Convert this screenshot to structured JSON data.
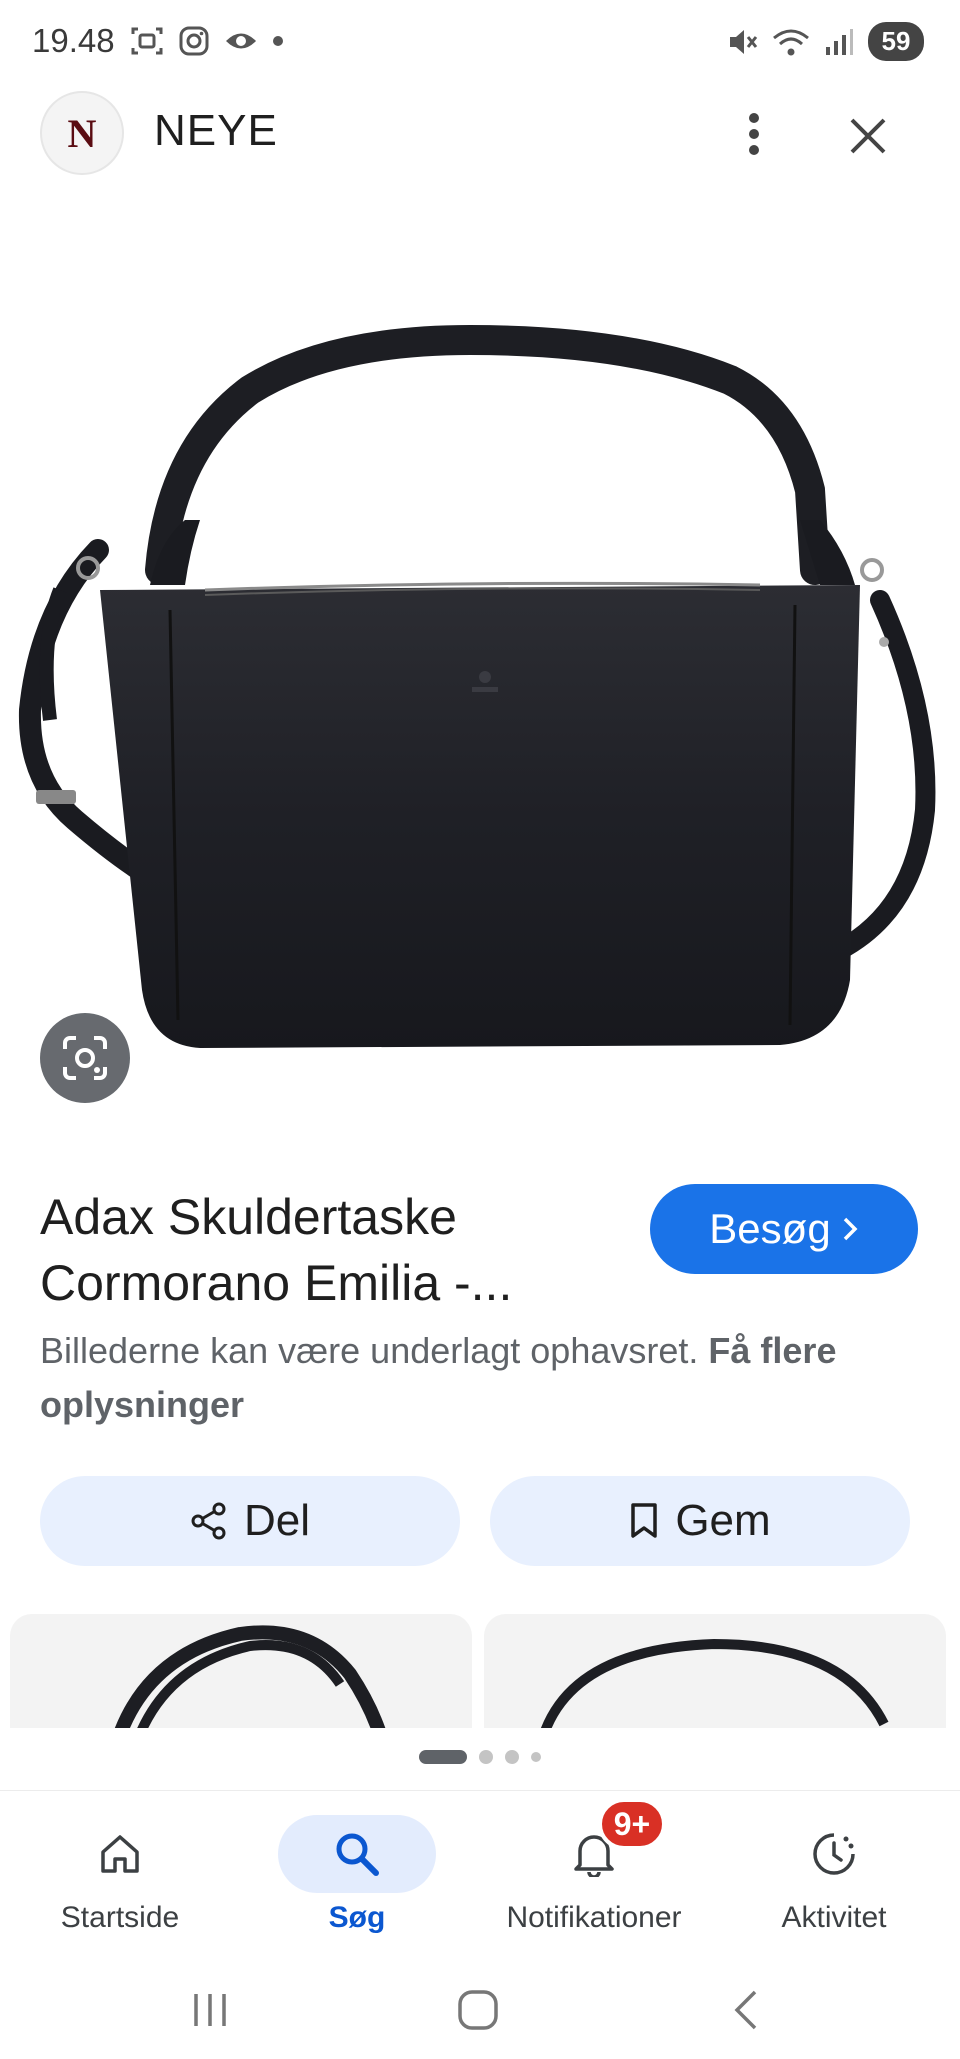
{
  "status_bar": {
    "time": "19.48",
    "battery": "59",
    "left_icons": [
      "screenshot-icon",
      "instagram-icon",
      "eye-icon",
      "dot-icon"
    ],
    "right_icons": [
      "mute-icon",
      "wifi-icon",
      "signal-icon"
    ]
  },
  "header": {
    "logo_letter": "N",
    "site_name": "NEYE",
    "menu_icon": "more-vert-icon",
    "close_icon": "close-icon"
  },
  "product": {
    "title_line1": "Adax Skuldertaske",
    "title_line2": "Cormorano Emilia -...",
    "visit_label": "Besøg",
    "copyright_text": "Billederne kan være underlagt ophavsret.",
    "more_info_label": "Få flere oplysninger"
  },
  "actions": {
    "share_label": "Del",
    "save_label": "Gem"
  },
  "pager": {
    "count": 4,
    "active": 0
  },
  "bottom_nav": {
    "items": [
      {
        "label": "Startside",
        "icon": "home-icon"
      },
      {
        "label": "Søg",
        "icon": "search-icon"
      },
      {
        "label": "Notifikationer",
        "icon": "bell-icon"
      },
      {
        "label": "Aktivitet",
        "icon": "activity-icon"
      }
    ],
    "active_index": 1,
    "notification_badge": "9+"
  },
  "colors": {
    "accent": "#1a73e8",
    "chip_bg": "#e8f0fe",
    "badge": "#d93025",
    "logo": "#5a0c12"
  }
}
